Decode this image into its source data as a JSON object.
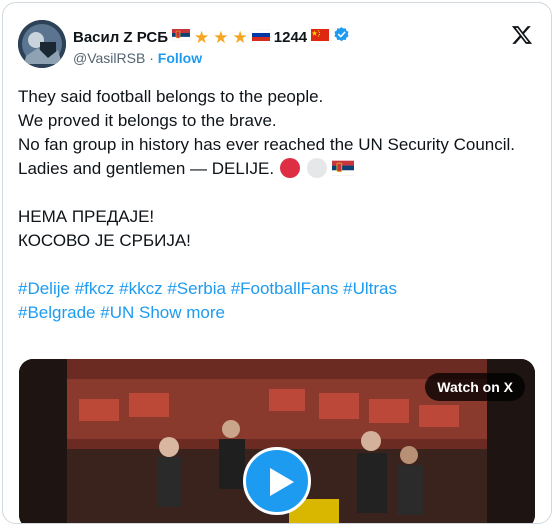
{
  "user": {
    "display_name": "Васил Z РСБ",
    "number": "1244",
    "handle": "@VasilRSB",
    "separator": "·",
    "follow_label": "Follow"
  },
  "post": {
    "lines": [
      "They said football belongs to the people.",
      "We proved it belongs to the brave.",
      "No fan group in history has ever reached the UN Security Council.",
      "Ladies and gentlemen — DELIJE."
    ],
    "lines2": [
      "НЕМА ПРЕДАЈЕ!",
      "КОСОВО ЈЕ СРБИЈА!"
    ],
    "hashtags": [
      "#Delije",
      "#fkcz",
      "#kkcz",
      "#Serbia",
      "#FootballFans",
      "#Ultras",
      "#Belgrade",
      "#UN"
    ],
    "show_more": "Show more"
  },
  "media": {
    "watch_label": "Watch on X"
  },
  "colors": {
    "accent": "#1d9bf0",
    "text": "#0f1419",
    "muted": "#536471",
    "star": "#f5a623"
  },
  "icons": [
    "serbia-flag-icon",
    "star-icon",
    "russia-flag-icon",
    "china-flag-icon",
    "verified-badge-icon",
    "x-logo-icon",
    "red-circle-icon",
    "white-circle-icon",
    "play-icon"
  ]
}
